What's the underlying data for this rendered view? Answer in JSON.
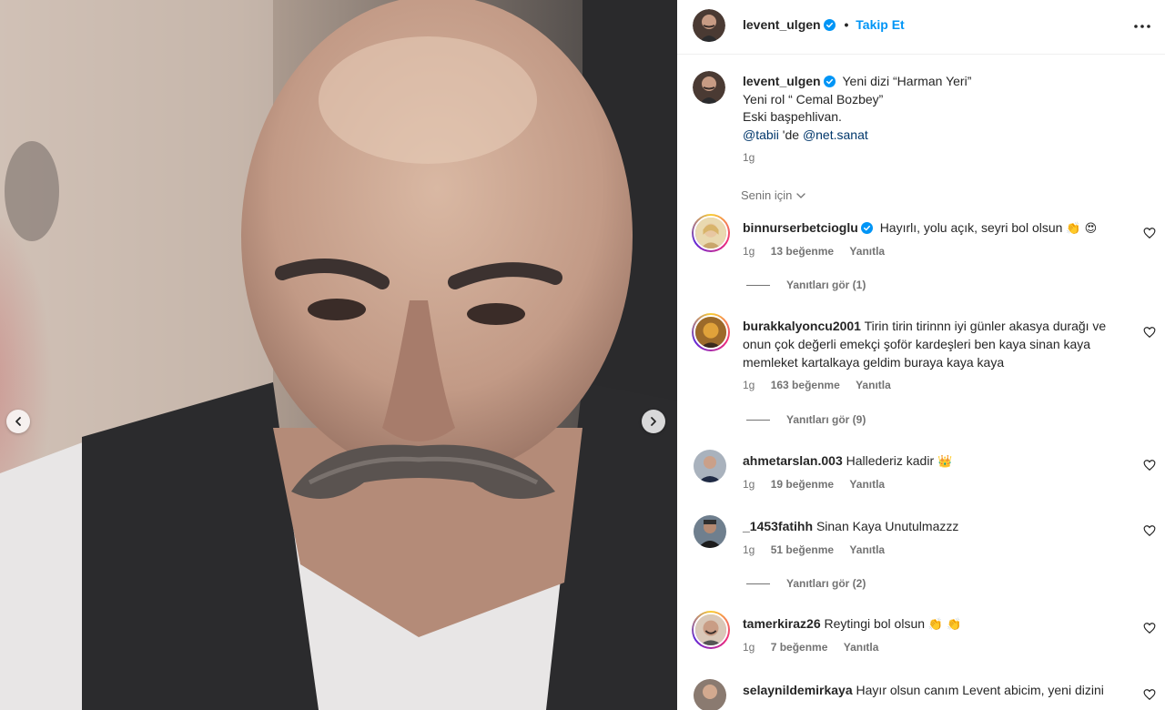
{
  "post": {
    "author": "levent_ulgen",
    "follow_label": "Takip Et",
    "dot": "•",
    "caption_lines": [
      "Yeni dizi “Harman Yeri”",
      "Yeni rol “ Cemal Bozbey”",
      "Eski başpehlivan."
    ],
    "caption_mention_1": "@tabii",
    "caption_mid": " 'de ",
    "caption_mention_2": "@net.sanat",
    "time": "1g",
    "for_you": "Senin için"
  },
  "comments": [
    {
      "user": "binnurserbetcioglu",
      "verified": true,
      "text": "Hayırlı, yolu açık, seyri bol olsun",
      "emoji": "👏 😍",
      "time": "1g",
      "likes": "13 beğenme",
      "reply": "Yanıtla",
      "view_replies": "Yanıtları gör (1)"
    },
    {
      "user": "burakkalyoncu2001",
      "verified": false,
      "text": "Tirin tirin tirinnn iyi günler akasya durağı ve onun çok değerli emekçi şoför kardeşleri ben kaya sinan kaya memleket kartalkaya geldim buraya kaya kaya",
      "emoji": "",
      "time": "1g",
      "likes": "163 beğenme",
      "reply": "Yanıtla",
      "view_replies": "Yanıtları gör (9)"
    },
    {
      "user": "ahmetarslan.003",
      "verified": false,
      "text": "Hallederiz kadir",
      "emoji": "👑",
      "time": "1g",
      "likes": "19 beğenme",
      "reply": "Yanıtla",
      "view_replies": ""
    },
    {
      "user": "_1453fatihh",
      "verified": false,
      "text": "Sinan Kaya Unutulmazzz",
      "emoji": "",
      "time": "1g",
      "likes": "51 beğenme",
      "reply": "Yanıtla",
      "view_replies": "Yanıtları gör (2)"
    },
    {
      "user": "tamerkiraz26",
      "verified": false,
      "text": "Reytingi bol olsun",
      "emoji": "👏 👏",
      "time": "1g",
      "likes": "7 beğenme",
      "reply": "Yanıtla",
      "view_replies": ""
    },
    {
      "user": "selaynildemirkaya",
      "verified": false,
      "text": "Hayır olsun canım Levent abicim, yeni dizini",
      "emoji": "",
      "time": "",
      "likes": "",
      "reply": "",
      "view_replies": ""
    }
  ],
  "icons": {
    "verified": "verified-badge-icon",
    "more": "more-options-icon",
    "heart": "heart-icon",
    "chevron": "chevron-down-icon",
    "prev": "chevron-left-icon",
    "next": "chevron-right-icon"
  },
  "colors": {
    "accent": "#0095f6",
    "mention": "#00376b",
    "secondary_text": "#737373"
  }
}
